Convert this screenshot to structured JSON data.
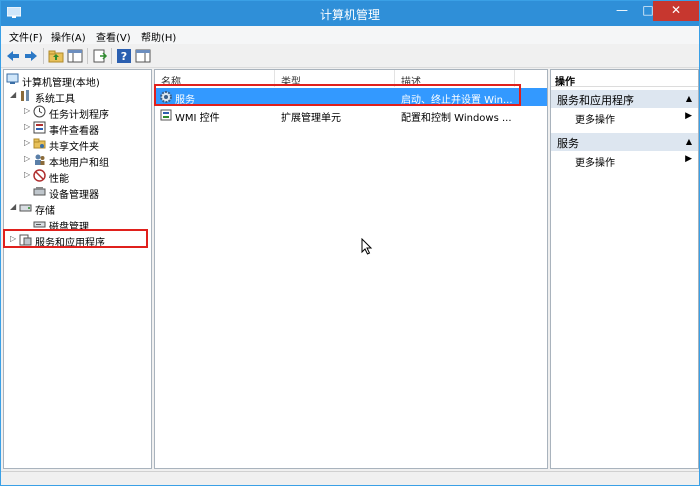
{
  "window": {
    "title": "计算机管理"
  },
  "menu": [
    "文件(F)",
    "操作(A)",
    "查看(V)",
    "帮助(H)"
  ],
  "tree": {
    "root": "计算机管理(本地)",
    "system_tools": "系统工具",
    "task_scheduler": "任务计划程序",
    "event_viewer": "事件查看器",
    "shared_folders": "共享文件夹",
    "local_users": "本地用户和组",
    "performance": "性能",
    "device_manager": "设备管理器",
    "storage": "存储",
    "disk_management": "磁盘管理",
    "services_apps": "服务和应用程序"
  },
  "list": {
    "columns": [
      "名称",
      "类型",
      "描述"
    ],
    "rows": [
      {
        "name": "服务",
        "type": "",
        "desc": "启动、终止并设置 Win..."
      },
      {
        "name": "WMI 控件",
        "type": "扩展管理单元",
        "desc": "配置和控制 Windows ..."
      }
    ]
  },
  "actions": {
    "header": "操作",
    "section1": "服务和应用程序",
    "section1_more": "更多操作",
    "section2": "服务",
    "section2_more": "更多操作"
  },
  "colors": {
    "titlebar": "#2f8fd8",
    "selection": "#3399ff",
    "highlight": "#e0201c"
  }
}
